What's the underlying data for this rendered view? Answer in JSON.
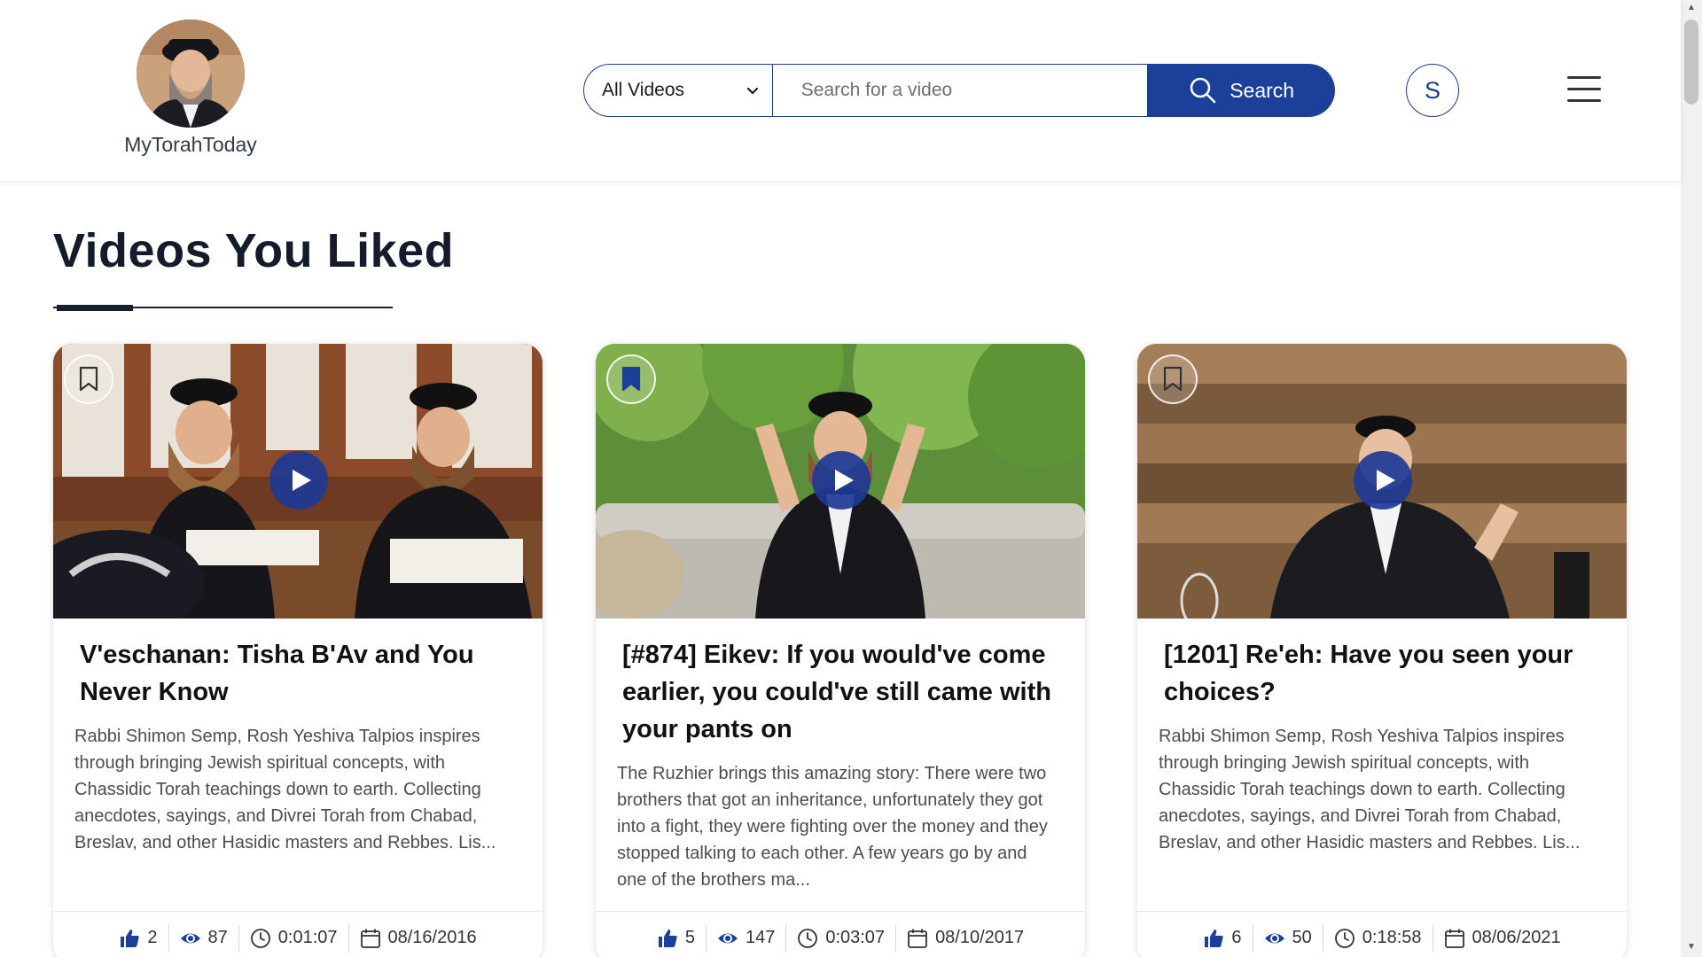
{
  "header": {
    "logo_text": "MyTorahToday",
    "filter_selected": "All Videos",
    "search_placeholder": "Search for a video",
    "search_label": "Search",
    "user_initial": "S"
  },
  "section": {
    "title": "Videos You Liked"
  },
  "colors": {
    "primary": "#1c3f9a",
    "heading": "#141c2b"
  },
  "cards": [
    {
      "title": "V'eschanan: Tisha B'Av and You Never Know",
      "description": "Rabbi Shimon Semp, Rosh Yeshiva Talpios inspires through bringing Jewish spiritual concepts, with Chassidic Torah teachings down to earth. Collecting anecdotes, sayings, and Divrei Torah from Chabad, Breslav, and other Hasidic masters and Rebbes. Lis...",
      "bookmarked": false,
      "likes": "2",
      "views": "87",
      "duration": "0:01:07",
      "date": "08/16/2016"
    },
    {
      "title": "[#874] Eikev: If you would've come earlier, you could've still came with your pants on",
      "description": "The Ruzhier brings this amazing story: There were two brothers that got an inheritance, unfortunately they got into a fight, they were fighting over the money and they stopped talking to each other. A few years go by and one of the brothers ma...",
      "bookmarked": true,
      "likes": "5",
      "views": "147",
      "duration": "0:03:07",
      "date": "08/10/2017"
    },
    {
      "title": "[1201] Re'eh: Have you seen your choices?",
      "description": "Rabbi Shimon Semp, Rosh Yeshiva Talpios inspires through bringing Jewish spiritual concepts, with Chassidic Torah teachings down to earth. Collecting anecdotes, sayings, and Divrei Torah from Chabad, Breslav, and other Hasidic masters and Rebbes. Lis...",
      "bookmarked": false,
      "likes": "6",
      "views": "50",
      "duration": "0:18:58",
      "date": "08/06/2021"
    }
  ]
}
